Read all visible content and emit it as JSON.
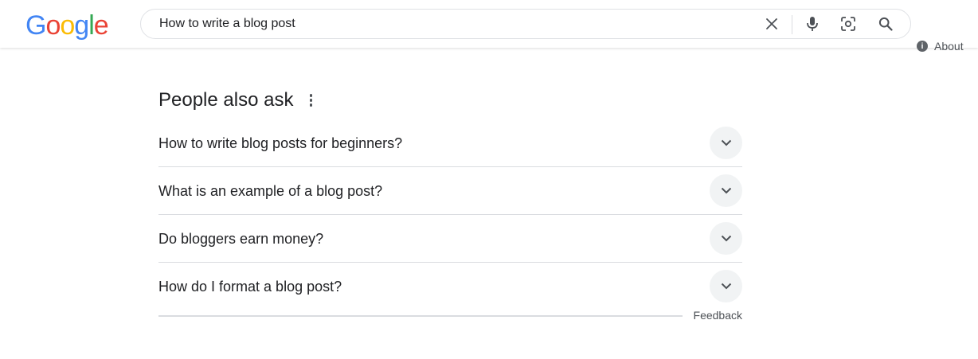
{
  "header": {
    "logo": {
      "letters": [
        "G",
        "o",
        "o",
        "g",
        "l",
        "e"
      ],
      "colors": [
        "#4285F4",
        "#EA4335",
        "#FBBC05",
        "#4285F4",
        "#34A853",
        "#EA4335"
      ]
    },
    "search": {
      "query": "How to write a blog post",
      "icons": [
        "close-icon",
        "microphone-icon",
        "lens-camera-icon",
        "search-icon"
      ]
    },
    "about_label": "About"
  },
  "paa": {
    "title": "People also ask",
    "menu_icon": "kebab-menu-icon",
    "questions": [
      {
        "text": "How to write blog posts for beginners?"
      },
      {
        "text": "What is an example of a blog post?"
      },
      {
        "text": "Do bloggers earn money?"
      },
      {
        "text": "How do I format a blog post?"
      }
    ],
    "feedback_label": "Feedback"
  },
  "colors": {
    "text": "#202124",
    "secondary_text": "#4d5156",
    "chevron_bg": "#f1f3f4",
    "divider": "#dadce0",
    "mic_blue": "#4285F4"
  }
}
